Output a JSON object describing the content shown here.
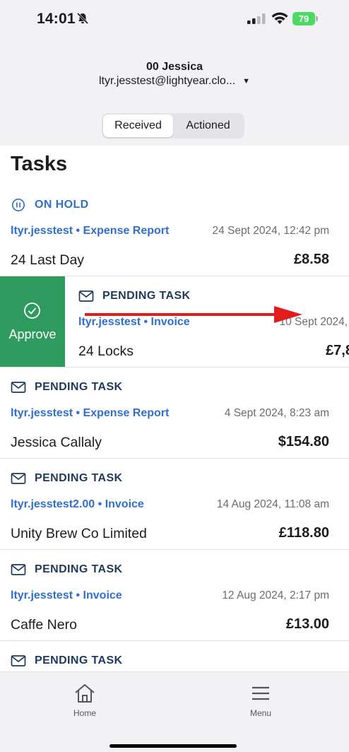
{
  "status_bar": {
    "time": "14:01",
    "battery": "79"
  },
  "header": {
    "user_name": "00 Jessica",
    "user_email": "ltyr.jesstest@lightyear.clo..."
  },
  "segments": {
    "received": "Received",
    "actioned": "Actioned"
  },
  "page_title": "Tasks",
  "tasks": [
    {
      "status": "ON HOLD",
      "meta": "ltyr.jesstest • Expense Report",
      "date": "24 Sept 2024, 12:42 pm",
      "name": "24 Last Day",
      "amount": "£8.58"
    },
    {
      "status": "PENDING TASK",
      "meta": "ltyr.jesstest • Invoice",
      "date": "10 Sept 2024,",
      "name": "24 Locks",
      "amount": "£7,8"
    },
    {
      "status": "PENDING TASK",
      "meta": "ltyr.jesstest • Expense Report",
      "date": "4 Sept 2024, 8:23 am",
      "name": "Jessica Callaly",
      "amount": "$154.80"
    },
    {
      "status": "PENDING TASK",
      "meta": "ltyr.jesstest2.00 • Invoice",
      "date": "14 Aug 2024, 11:08 am",
      "name": "Unity Brew Co Limited",
      "amount": "£118.80"
    },
    {
      "status": "PENDING TASK",
      "meta": "ltyr.jesstest • Invoice",
      "date": "12 Aug 2024, 2:17 pm",
      "name": "Caffe Nero",
      "amount": "£13.00"
    },
    {
      "status": "PENDING TASK"
    }
  ],
  "swipe_action": {
    "label": "Approve",
    "color": "#2e9a5e"
  },
  "tab_bar": {
    "home": "Home",
    "menu": "Menu"
  },
  "colors": {
    "accent_blue": "#2f6fd1",
    "pending_navy": "#1f3a5c",
    "annotation_arrow": "#e31b1b"
  }
}
